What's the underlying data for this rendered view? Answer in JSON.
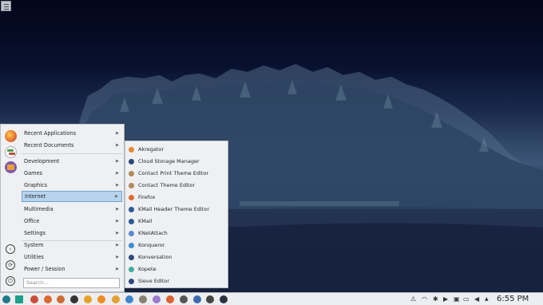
{
  "desktop": {
    "toolbox_icon": "menu-icon"
  },
  "menu": {
    "favorites": [
      {
        "name": "firefox-icon",
        "color": "#e66a2c"
      },
      {
        "name": "system-settings-icon",
        "color": "#3fa34d"
      },
      {
        "name": "file-manager-icon",
        "color": "#f0a030"
      }
    ],
    "items": [
      {
        "label": "Recent Applications",
        "arrow": "▶"
      },
      {
        "label": "Recent Documents",
        "arrow": "▶"
      },
      {
        "label": "Development",
        "arrow": "▶"
      },
      {
        "label": "Games",
        "arrow": "▶"
      },
      {
        "label": "Graphics",
        "arrow": "▶"
      },
      {
        "label": "Internet",
        "arrow": "▶"
      },
      {
        "label": "Multimedia",
        "arrow": "▶"
      },
      {
        "label": "Office",
        "arrow": "▶"
      },
      {
        "label": "Settings",
        "arrow": "▶"
      },
      {
        "label": "System",
        "arrow": "▶"
      },
      {
        "label": "Utilities",
        "arrow": "▶"
      },
      {
        "label": "Power / Session",
        "arrow": "▶"
      }
    ],
    "selected": "Internet",
    "search_placeholder": "Search...",
    "side_buttons": [
      {
        "name": "back-icon",
        "glyph": "‹"
      },
      {
        "name": "refresh-icon",
        "glyph": "⟳"
      },
      {
        "name": "power-icon",
        "glyph": "⏻"
      }
    ]
  },
  "submenu": {
    "items": [
      {
        "label": "Akregator",
        "icon": "akregator-icon",
        "color": "#e8862c"
      },
      {
        "label": "Cloud Storage Manager",
        "icon": "cloud-storage-icon",
        "color": "#2c4a7a"
      },
      {
        "label": "Contact Print Theme Editor",
        "icon": "theme-editor-icon",
        "color": "#b58a5a"
      },
      {
        "label": "Contact Theme Editor",
        "icon": "theme-editor-icon",
        "color": "#b58a5a"
      },
      {
        "label": "Firefox",
        "icon": "firefox-icon",
        "color": "#e4682a"
      },
      {
        "label": "KMail Header Theme Editor",
        "icon": "kmail-icon",
        "color": "#2a5a9a"
      },
      {
        "label": "KMail",
        "icon": "kmail-icon",
        "color": "#2a5a9a"
      },
      {
        "label": "KNetAttach",
        "icon": "knetattach-icon",
        "color": "#5a8ad0"
      },
      {
        "label": "Konqueror",
        "icon": "konqueror-icon",
        "color": "#3a8ed8"
      },
      {
        "label": "Konversation",
        "icon": "konversation-icon",
        "color": "#2c4a7a"
      },
      {
        "label": "Kopete",
        "icon": "kopete-icon",
        "color": "#3ab0a0"
      },
      {
        "label": "Sieve Editor",
        "icon": "sieve-editor-icon",
        "color": "#2a4a80"
      }
    ]
  },
  "taskbar": {
    "launchers": [
      {
        "name": "app-launcher-icon",
        "color": "#1f7a8c"
      },
      {
        "name": "show-desktop-icon",
        "color": "#1aa08a"
      },
      {
        "name": "chromium-icon",
        "color": "#d04a3a"
      },
      {
        "name": "firefox-icon",
        "color": "#e0662a"
      },
      {
        "name": "firefox-alt-icon",
        "color": "#d06a30"
      },
      {
        "name": "krita-icon",
        "color": "#333333"
      },
      {
        "name": "kate-icon",
        "color": "#e8a020"
      },
      {
        "name": "vlc-icon",
        "color": "#f08c1c"
      },
      {
        "name": "audacity-icon",
        "color": "#e8a030"
      },
      {
        "name": "dolphin-icon",
        "color": "#3a86cc"
      },
      {
        "name": "gimp-icon",
        "color": "#8a8070"
      },
      {
        "name": "kdenlive-icon",
        "color": "#9a7ad0"
      },
      {
        "name": "clementine-icon",
        "color": "#e06030"
      },
      {
        "name": "inkscape-icon",
        "color": "#555555"
      },
      {
        "name": "virtualbox-icon",
        "color": "#3a6ab0"
      },
      {
        "name": "sync-icon",
        "color": "#444444"
      },
      {
        "name": "terminal-icon",
        "color": "#2a3240"
      }
    ],
    "tray_icons": [
      {
        "name": "network-manager-icon",
        "glyph": "⚠"
      },
      {
        "name": "wifi-icon",
        "glyph": "◠"
      },
      {
        "name": "bluetooth-icon",
        "glyph": "✱"
      },
      {
        "name": "media-player-icon",
        "glyph": "▶"
      },
      {
        "name": "clipboard-icon",
        "glyph": "▣"
      },
      {
        "name": "battery-icon",
        "glyph": "▭"
      },
      {
        "name": "volume-icon",
        "glyph": "◀"
      },
      {
        "name": "expand-tray-icon",
        "glyph": "▲"
      }
    ],
    "clock": "6:55 PM"
  }
}
